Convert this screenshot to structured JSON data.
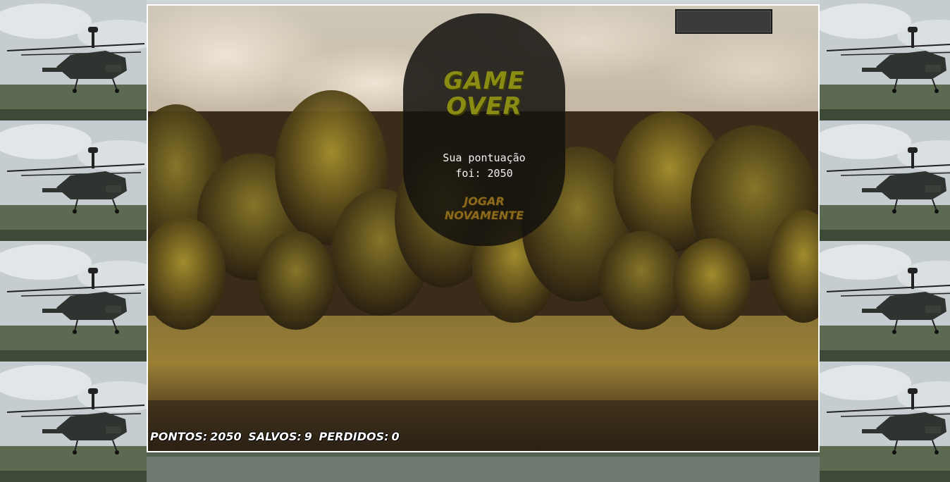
{
  "game_over": {
    "title_line1": "GAME",
    "title_line2": "OVER",
    "score_line1": "Sua pontuação",
    "score_line2": "foi: 2050",
    "play_again_line1": "JOGAR",
    "play_again_line2": "NOVAMENTE"
  },
  "hud": {
    "points_label": "PONTOS:",
    "points_value": "2050",
    "saved_label": "SALVOS:",
    "saved_value": "9",
    "lost_label": "PERDIDOS:",
    "lost_value": "0"
  },
  "colors": {
    "title": "#8a8c14",
    "play_again": "#8c6a1c",
    "panel_bg": "#14120e",
    "frame_border": "#ffffff"
  },
  "icons": {
    "wallpaper": "helicopter-icon",
    "energy_bar": "energy-bar"
  }
}
